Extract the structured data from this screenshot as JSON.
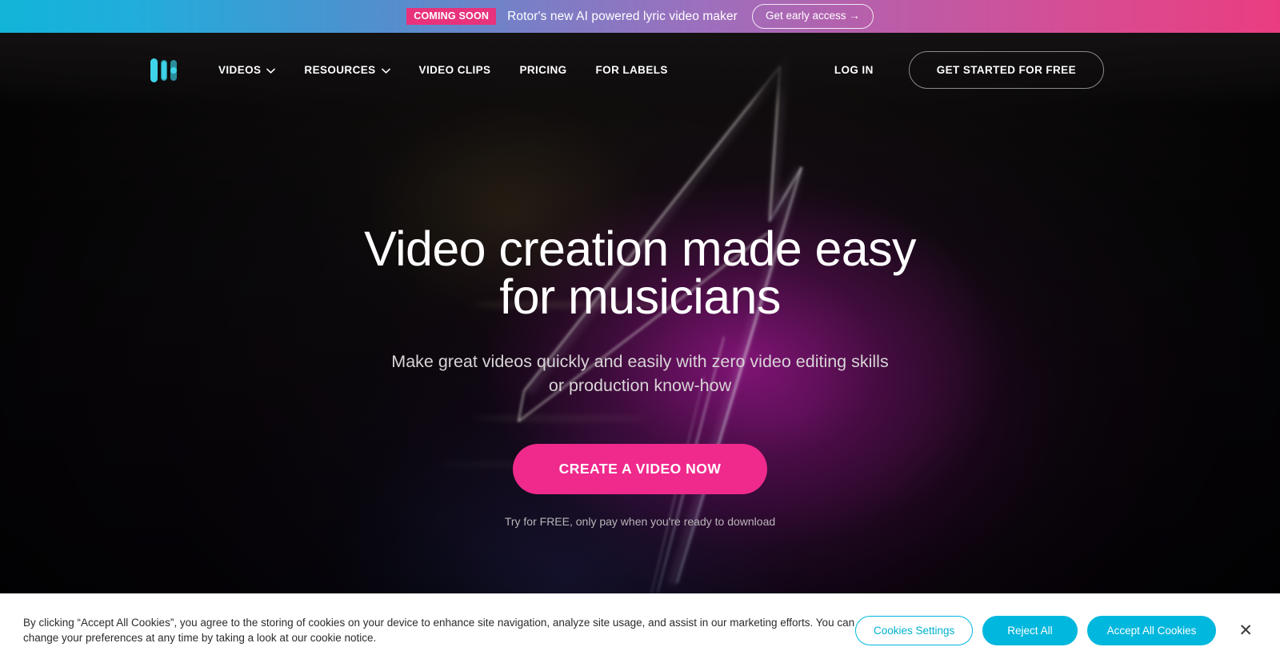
{
  "promo": {
    "tag": "COMING SOON",
    "message": "Rotor's new AI powered lyric video maker",
    "cta": "Get early access →"
  },
  "nav": {
    "logo_name": "rotor-logo",
    "links": [
      {
        "label": "VIDEOS",
        "has_dropdown": true
      },
      {
        "label": "RESOURCES",
        "has_dropdown": true
      },
      {
        "label": "VIDEO CLIPS",
        "has_dropdown": false
      },
      {
        "label": "PRICING",
        "has_dropdown": false
      },
      {
        "label": "FOR LABELS",
        "has_dropdown": false
      }
    ],
    "login": "LOG IN",
    "cta": "GET STARTED FOR FREE"
  },
  "hero": {
    "title_line1": "Video creation made easy",
    "title_line2": "for musicians",
    "subtitle_line1": "Make great videos quickly and easily with zero video editing skills",
    "subtitle_line2": "or production know-how",
    "cta": "CREATE A VIDEO NOW",
    "note": "Try for FREE, only pay when you're ready to download"
  },
  "cookie": {
    "text": "By clicking “Accept All Cookies”, you agree to the storing of cookies on your device to enhance site navigation, analyze site usage, and assist in our marketing efforts. You can change your preferences at any time by taking a look at our cookie notice.",
    "settings": "Cookies Settings",
    "reject": "Reject All",
    "accept": "Accept All Cookies",
    "close": "✕"
  },
  "colors": {
    "accent_pink": "#f02a8c",
    "accent_cyan": "#00b7dd",
    "logo_cyan": "#3ed3e8",
    "banner_left": "#12b4d8",
    "banner_right": "#ea3d80",
    "tag_pink": "#e8327c"
  }
}
